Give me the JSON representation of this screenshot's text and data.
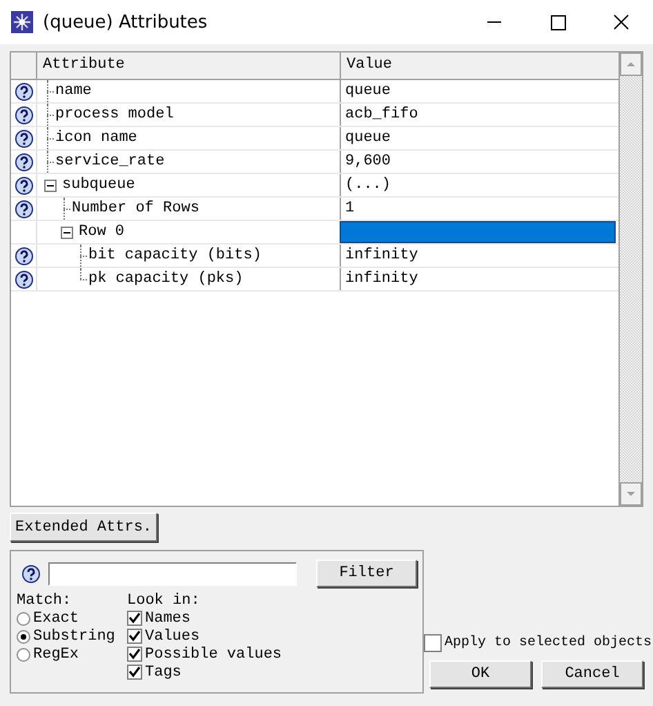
{
  "window": {
    "title": "(queue) Attributes"
  },
  "table": {
    "columns": [
      "Attribute",
      "Value"
    ],
    "rows": [
      {
        "attribute": "name",
        "value": "queue",
        "help": true,
        "selected": false
      },
      {
        "attribute": "process model",
        "value": "acb_fifo",
        "help": true,
        "selected": false
      },
      {
        "attribute": "icon name",
        "value": "queue",
        "help": true,
        "selected": false
      },
      {
        "attribute": "service_rate",
        "value": "9,600",
        "help": true,
        "selected": false
      },
      {
        "attribute": "subqueue",
        "value": "(...)",
        "help": true,
        "expanded": true,
        "selected": false,
        "children": [
          {
            "attribute": "Number of Rows",
            "value": "1",
            "help": true,
            "selected": false
          },
          {
            "attribute": "Row 0",
            "help": false,
            "expanded": true,
            "selected": true,
            "children": [
              {
                "attribute": "bit capacity (bits)",
                "value": "infinity",
                "help": true,
                "selected": false
              },
              {
                "attribute": "pk capacity (pks)",
                "value": "infinity",
                "help": true,
                "selected": false
              }
            ]
          }
        ]
      }
    ]
  },
  "extended_button": "Extended Attrs.",
  "filter": {
    "button": "Filter",
    "match_label": "Match:",
    "match": [
      {
        "label": "Exact",
        "selected": false
      },
      {
        "label": "Substring",
        "selected": true
      },
      {
        "label": "RegEx",
        "selected": false
      }
    ],
    "look_in_label": "Look in:",
    "look_in": [
      {
        "label": "Names",
        "checked": true
      },
      {
        "label": "Values",
        "checked": true
      },
      {
        "label": "Possible values",
        "checked": true
      },
      {
        "label": "Tags",
        "checked": true
      }
    ]
  },
  "apply": {
    "label": "Apply to selected objects",
    "checked": false
  },
  "buttons": [
    "OK",
    "Cancel"
  ]
}
